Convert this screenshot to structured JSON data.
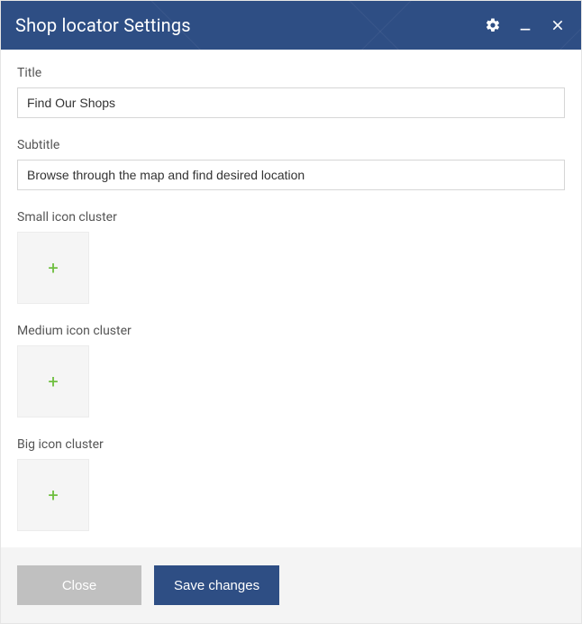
{
  "header": {
    "title": "Shop locator Settings"
  },
  "fields": {
    "title": {
      "label": "Title",
      "value": "Find Our Shops"
    },
    "subtitle": {
      "label": "Subtitle",
      "value": "Browse through the map and find desired location"
    },
    "small_cluster": {
      "label": "Small icon cluster"
    },
    "medium_cluster": {
      "label": "Medium icon cluster"
    },
    "big_cluster": {
      "label": "Big icon cluster"
    }
  },
  "footer": {
    "close": "Close",
    "save": "Save changes"
  }
}
